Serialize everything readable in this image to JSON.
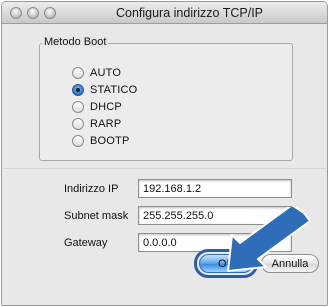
{
  "window": {
    "title": "Configura indirizzo TCP/IP"
  },
  "boot_method": {
    "legend": "Metodo Boot",
    "options": [
      {
        "label": "AUTO",
        "selected": false
      },
      {
        "label": "STATICO",
        "selected": true
      },
      {
        "label": "DHCP",
        "selected": false
      },
      {
        "label": "RARP",
        "selected": false
      },
      {
        "label": "BOOTP",
        "selected": false
      }
    ]
  },
  "network": {
    "ip_label": "Indirizzo IP",
    "ip_value": "192.168.1.2",
    "subnet_label": "Subnet mask",
    "subnet_value": "255.255.255.0",
    "gateway_label": "Gateway",
    "gateway_value": "0.0.0.0"
  },
  "buttons": {
    "ok": "OK",
    "cancel": "Annulla"
  },
  "colors": {
    "accent": "#2a5fa8",
    "arrow": "#2f6db8"
  }
}
